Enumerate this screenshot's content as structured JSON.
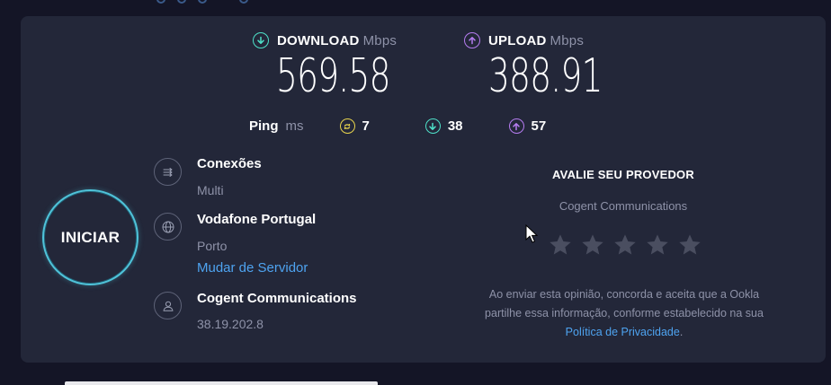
{
  "download": {
    "label": "DOWNLOAD",
    "unit": "Mbps",
    "value": "569.58",
    "color": "#4ee0c8",
    "icon": "arrow-down-circle-icon"
  },
  "upload": {
    "label": "UPLOAD",
    "unit": "Mbps",
    "value": "388.91",
    "color": "#b57cf0",
    "icon": "arrow-up-circle-icon"
  },
  "ping": {
    "label": "Ping",
    "unit": "ms",
    "idle": {
      "value": "7",
      "color": "#e8d44d",
      "icon": "ping-idle-icon"
    },
    "download": {
      "value": "38",
      "color": "#4ee0c8",
      "icon": "arrow-down-circle-icon"
    },
    "upload": {
      "value": "57",
      "color": "#b57cf0",
      "icon": "arrow-up-circle-icon"
    }
  },
  "start_button": {
    "label": "INICIAR",
    "color": "#4fc3d9"
  },
  "connections": {
    "title": "Conexões",
    "value": "Multi",
    "icon": "connections-icon"
  },
  "server": {
    "name": "Vodafone Portugal",
    "location": "Porto",
    "change_link": "Mudar de Servidor",
    "icon": "globe-icon"
  },
  "provider": {
    "name": "Cogent Communications",
    "ip": "38.19.202.8",
    "icon": "user-icon"
  },
  "rate": {
    "title": "AVALIE SEU PROVEDOR",
    "provider": "Cogent Communications",
    "stars_total": 5,
    "stars_selected": 0,
    "disclaimer_line1": "Ao enviar esta opinião, concorda e aceita que a Ookla",
    "disclaimer_line2": "partilhe essa informação, conforme estabelecido na sua",
    "privacy_link": "Política de Privacidade",
    "privacy_suffix": "."
  }
}
